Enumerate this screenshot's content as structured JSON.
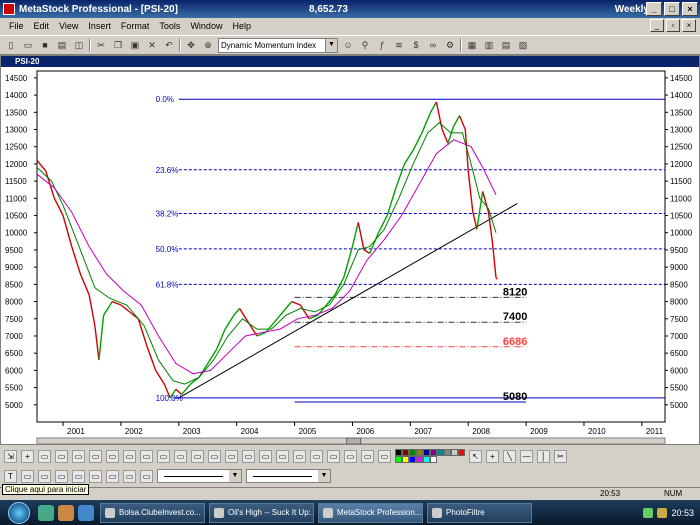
{
  "window": {
    "title": "MetaStock Professional - [PSI-20]",
    "last_value": "8,652.73",
    "period": "Weekly"
  },
  "menu": [
    "File",
    "Edit",
    "View",
    "Insert",
    "Format",
    "Tools",
    "Window",
    "Help"
  ],
  "toolbar": {
    "indicator_combo": "Dynamic Momentum Index"
  },
  "chart": {
    "window_title": "PSI-20",
    "colors": {
      "price_up": "#00a000",
      "price_down": "#d00000",
      "ma_fast": "#008000",
      "ma_slow": "#c000c0",
      "fib_line": "#0000c0",
      "trendline": "#000000",
      "level_red": "#ff4040"
    },
    "fib_labels": [
      "0.0%",
      "23.6%",
      "38.2%",
      "50.0%",
      "61.8%",
      "100.0%"
    ],
    "level_labels": [
      "8120",
      "7400",
      "6686",
      "5080"
    ]
  },
  "chart_data": {
    "type": "line",
    "title": "PSI-20",
    "x_tick_labels": [
      "2001",
      "2002",
      "2003",
      "2004",
      "2005",
      "2006",
      "2007",
      "2008",
      "2009",
      "2010",
      "2011"
    ],
    "y_tick_labels": [
      "5000",
      "5500",
      "6000",
      "6500",
      "7000",
      "7500",
      "8000",
      "8500",
      "9000",
      "9500",
      "10000",
      "10500",
      "11000",
      "11500",
      "12000",
      "12500",
      "13000",
      "13500",
      "14000",
      "14500"
    ],
    "ylim": [
      4500,
      14700
    ],
    "xlim": [
      2000.55,
      2011.4
    ],
    "series": [
      {
        "values": [
          [
            2000.55,
            12100
          ],
          [
            2000.7,
            11800
          ],
          [
            2000.85,
            11000
          ],
          [
            2001.0,
            10500
          ],
          [
            2001.15,
            9600
          ],
          [
            2001.3,
            8800
          ],
          [
            2001.45,
            8200
          ],
          [
            2001.55,
            7300
          ],
          [
            2001.62,
            6300
          ],
          [
            2001.7,
            7600
          ],
          [
            2001.85,
            8000
          ],
          [
            2002.0,
            7900
          ],
          [
            2002.15,
            7700
          ],
          [
            2002.3,
            7500
          ],
          [
            2002.45,
            6700
          ],
          [
            2002.6,
            6000
          ],
          [
            2002.75,
            5600
          ],
          [
            2002.85,
            5200
          ],
          [
            2002.95,
            5450
          ],
          [
            2003.05,
            5300
          ],
          [
            2003.2,
            5600
          ],
          [
            2003.35,
            5800
          ],
          [
            2003.5,
            6200
          ],
          [
            2003.65,
            6600
          ],
          [
            2003.8,
            7200
          ],
          [
            2003.95,
            7600
          ],
          [
            2004.05,
            7800
          ],
          [
            2004.2,
            7400
          ],
          [
            2004.35,
            7000
          ],
          [
            2004.5,
            7100
          ],
          [
            2004.65,
            7400
          ],
          [
            2004.8,
            7700
          ],
          [
            2004.95,
            8000
          ],
          [
            2005.1,
            7900
          ],
          [
            2005.25,
            7500
          ],
          [
            2005.4,
            7600
          ],
          [
            2005.55,
            7900
          ],
          [
            2005.7,
            8200
          ],
          [
            2005.85,
            8700
          ],
          [
            2006.0,
            9600
          ],
          [
            2006.1,
            10300
          ],
          [
            2006.2,
            9500
          ],
          [
            2006.3,
            9400
          ],
          [
            2006.45,
            10000
          ],
          [
            2006.6,
            10500
          ],
          [
            2006.75,
            11300
          ],
          [
            2006.9,
            12000
          ],
          [
            2007.05,
            12400
          ],
          [
            2007.2,
            12900
          ],
          [
            2007.35,
            13500
          ],
          [
            2007.45,
            13800
          ],
          [
            2007.55,
            13000
          ],
          [
            2007.65,
            12600
          ],
          [
            2007.75,
            13100
          ],
          [
            2007.85,
            13400
          ],
          [
            2007.95,
            13000
          ],
          [
            2008.0,
            11800
          ],
          [
            2008.08,
            10600
          ],
          [
            2008.15,
            10100
          ],
          [
            2008.25,
            11200
          ],
          [
            2008.35,
            10600
          ],
          [
            2008.42,
            9700
          ],
          [
            2008.48,
            8700
          ],
          [
            2008.5,
            8650
          ]
        ]
      },
      {
        "values": [
          [
            2000.55,
            11900
          ],
          [
            2000.8,
            11500
          ],
          [
            2001.0,
            10800
          ],
          [
            2001.3,
            9500
          ],
          [
            2001.55,
            8400
          ],
          [
            2001.8,
            8100
          ],
          [
            2002.1,
            7900
          ],
          [
            2002.4,
            7300
          ],
          [
            2002.65,
            6300
          ],
          [
            2002.9,
            5700
          ],
          [
            2003.1,
            5600
          ],
          [
            2003.35,
            5800
          ],
          [
            2003.6,
            6300
          ],
          [
            2003.85,
            7000
          ],
          [
            2004.1,
            7500
          ],
          [
            2004.35,
            7200
          ],
          [
            2004.6,
            7200
          ],
          [
            2004.85,
            7600
          ],
          [
            2005.1,
            7800
          ],
          [
            2005.35,
            7700
          ],
          [
            2005.6,
            7900
          ],
          [
            2005.85,
            8500
          ],
          [
            2006.1,
            9500
          ],
          [
            2006.3,
            9600
          ],
          [
            2006.55,
            10100
          ],
          [
            2006.8,
            11000
          ],
          [
            2007.05,
            12000
          ],
          [
            2007.3,
            12900
          ],
          [
            2007.5,
            13200
          ],
          [
            2007.7,
            12900
          ],
          [
            2007.9,
            12900
          ],
          [
            2008.05,
            12000
          ],
          [
            2008.2,
            11000
          ],
          [
            2008.35,
            10700
          ],
          [
            2008.48,
            10000
          ]
        ]
      },
      {
        "values": [
          [
            2000.55,
            11700
          ],
          [
            2000.85,
            11300
          ],
          [
            2001.15,
            10600
          ],
          [
            2001.45,
            9600
          ],
          [
            2001.75,
            8800
          ],
          [
            2002.05,
            8300
          ],
          [
            2002.35,
            7900
          ],
          [
            2002.65,
            7000
          ],
          [
            2002.95,
            6200
          ],
          [
            2003.25,
            5900
          ],
          [
            2003.55,
            6000
          ],
          [
            2003.85,
            6500
          ],
          [
            2004.15,
            7000
          ],
          [
            2004.45,
            7100
          ],
          [
            2004.75,
            7200
          ],
          [
            2005.05,
            7500
          ],
          [
            2005.35,
            7600
          ],
          [
            2005.65,
            7800
          ],
          [
            2005.95,
            8300
          ],
          [
            2006.25,
            9200
          ],
          [
            2006.55,
            9800
          ],
          [
            2006.85,
            10500
          ],
          [
            2007.15,
            11400
          ],
          [
            2007.45,
            12300
          ],
          [
            2007.75,
            12700
          ],
          [
            2008.05,
            12500
          ],
          [
            2008.25,
            11900
          ],
          [
            2008.48,
            11100
          ]
        ]
      }
    ],
    "fib_levels": [
      {
        "label": "0.0%",
        "y": 13880
      },
      {
        "label": "23.6%",
        "y": 11830
      },
      {
        "label": "38.2%",
        "y": 10560
      },
      {
        "label": "50.0%",
        "y": 9530
      },
      {
        "label": "61.8%",
        "y": 8500
      },
      {
        "label": "100.0%",
        "y": 5200
      }
    ],
    "horizontal_levels": [
      {
        "label": "8120",
        "y": 8120
      },
      {
        "label": "7400",
        "y": 7400
      },
      {
        "label": "6686",
        "y": 6686
      },
      {
        "label": "5080",
        "y": 5080
      }
    ],
    "trendline": [
      [
        2003.0,
        5200
      ],
      [
        2008.85,
        10850
      ]
    ]
  },
  "status": {
    "tooltip": "Clique aqui para iniciar",
    "clock": "20:53",
    "num": "NUM"
  },
  "taskbar": {
    "tasks": [
      "Bolsa.ClubeInvest.co...",
      "Oil's High -- Suck It Up:...",
      "MetaStock Profession...",
      "PhotoFiltre"
    ],
    "time": "20:53"
  }
}
